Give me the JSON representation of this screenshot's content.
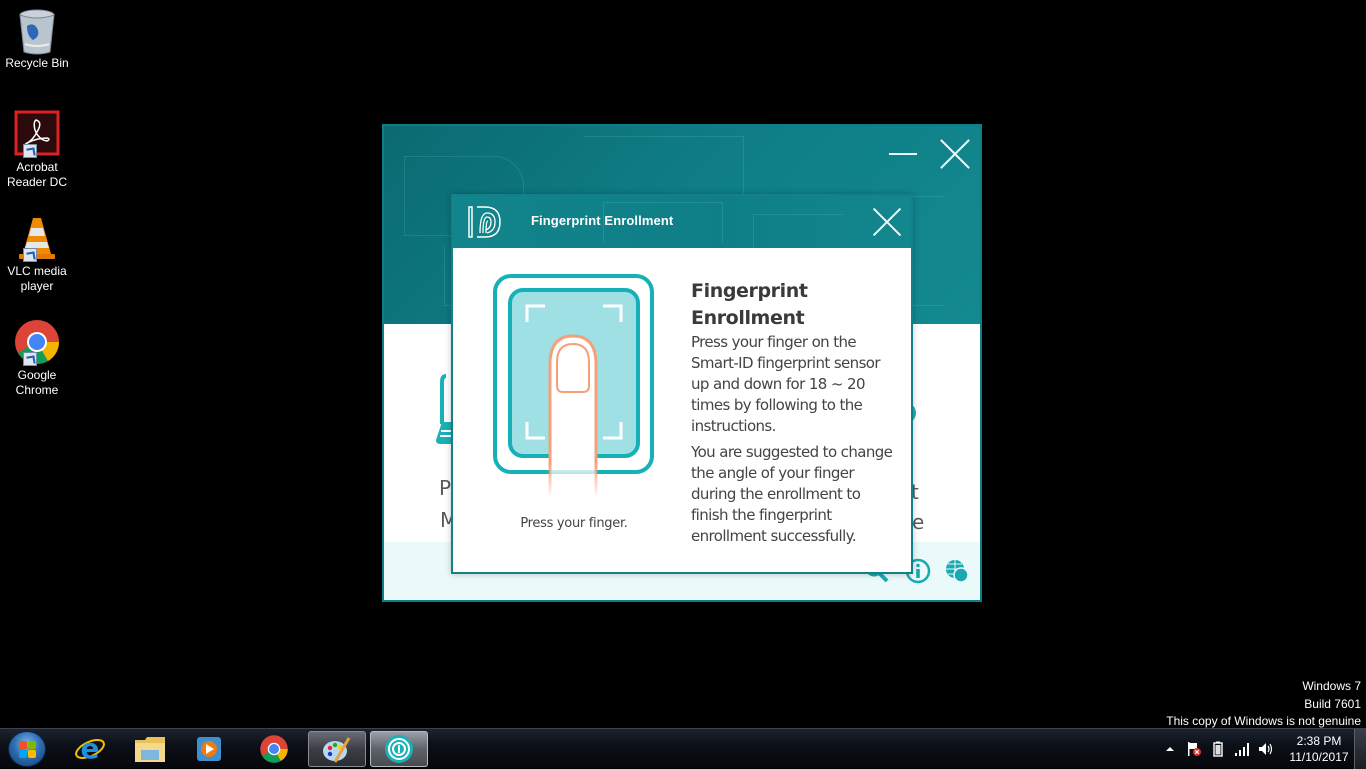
{
  "desktop": {
    "icons": [
      {
        "label_line1": "Recycle Bin",
        "label_line2": "",
        "icon": "recycle-bin-icon"
      },
      {
        "label_line1": "Acrobat",
        "label_line2": "Reader DC",
        "icon": "acrobat-reader-icon"
      },
      {
        "label_line1": "VLC media",
        "label_line2": "player",
        "icon": "vlc-icon"
      },
      {
        "label_line1": "Google",
        "label_line2": "Chrome",
        "icon": "chrome-icon"
      }
    ]
  },
  "app_window": {
    "partial_texts": {
      "left_line1": "P",
      "left_line2": "M",
      "right_line1": "t",
      "right_line2": "ce"
    },
    "footer_icons": [
      "search-icon",
      "info-icon",
      "language-globe-icon"
    ],
    "accent_color": "#0f7f86"
  },
  "dialog": {
    "title": "Fingerprint Enrollment",
    "illustration_caption": "Press your finger.",
    "heading": "Fingerprint Enrollment",
    "paragraphs": [
      "Press your finger on the Smart-ID fingerprint sensor up and down for 18 ~ 20 times by following to the instructions.",
      "You are suggested to change the angle of your finger during the enrollment to finish the fingerprint enrollment successfully."
    ],
    "colors": {
      "header": "#12848c",
      "sensor": "#1ab0b8",
      "finger_outline": "#f4a07a"
    }
  },
  "taskbar": {
    "pinned": [
      {
        "name": "internet-explorer",
        "icon": "ie-icon"
      },
      {
        "name": "file-explorer",
        "icon": "folder-icon"
      },
      {
        "name": "media-player",
        "icon": "media-player-icon"
      },
      {
        "name": "chrome",
        "icon": "chrome-icon"
      },
      {
        "name": "paint",
        "icon": "paint-palette-icon"
      },
      {
        "name": "smart-id",
        "icon": "smart-id-icon"
      }
    ],
    "clock_time": "2:38 PM",
    "clock_date": "11/10/2017"
  },
  "watermark": {
    "line1": "Windows 7",
    "line2": "Build 7601",
    "line3": "This copy of Windows is not genuine"
  }
}
